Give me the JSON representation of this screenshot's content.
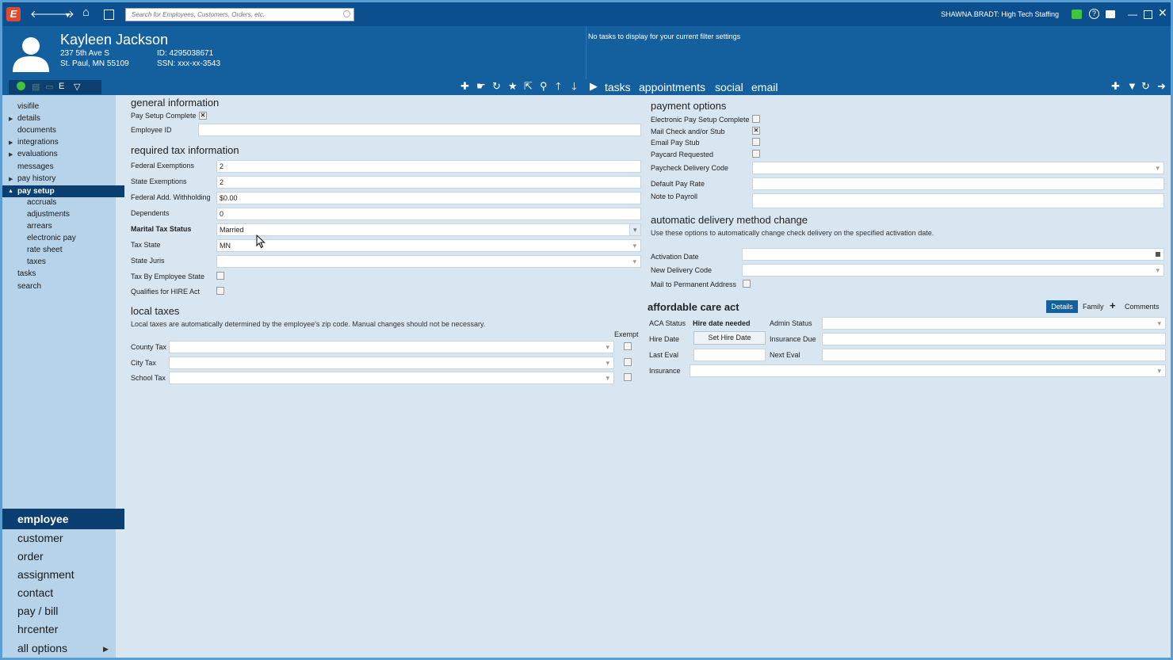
{
  "titlebar": {
    "search_placeholder": "Search for Employees, Customers, Orders, etc.",
    "user": "SHAWNA.BRADT: High Tech Staffing"
  },
  "record": {
    "name": "Kayleen Jackson",
    "address1": "237 5th Ave S",
    "address2": "St. Paul, MN 55109",
    "id": "ID: 4295038671",
    "ssn": "SSN: xxx-xx-3543"
  },
  "tasks_message": "No tasks to display for your current filter settings",
  "status_letter": "E",
  "header_tabs": [
    "tasks",
    "appointments",
    "social",
    "email"
  ],
  "sidebar": {
    "items": [
      "visifile",
      "details",
      "documents",
      "integrations",
      "evaluations",
      "messages",
      "pay history",
      "pay setup"
    ],
    "subitems": [
      "accruals",
      "adjustments",
      "arrears",
      "electronic pay",
      "rate sheet",
      "taxes"
    ],
    "after": [
      "tasks",
      "search"
    ],
    "bignav": [
      "employee",
      "customer",
      "order",
      "assignment",
      "contact",
      "pay / bill",
      "hrcenter",
      "all options"
    ]
  },
  "general": {
    "title": "general information",
    "pay_setup_complete": "Pay Setup Complete",
    "employee_id": "Employee ID"
  },
  "tax": {
    "title": "required tax information",
    "federal_exemptions_label": "Federal Exemptions",
    "federal_exemptions": "2",
    "state_exemptions_label": "State Exemptions",
    "state_exemptions": "2",
    "federal_add_label": "Federal Add. Withholding",
    "federal_add": "$0.00",
    "dependents_label": "Dependents",
    "dependents": "0",
    "marital_label": "Marital Tax Status",
    "marital": "Married",
    "tax_state_label": "Tax State",
    "tax_state": "MN",
    "state_juris_label": "State Juris",
    "tax_by_state_label": "Tax By Employee State",
    "hire_act_label": "Qualifies for HIRE Act"
  },
  "local": {
    "title": "local taxes",
    "note": "Local taxes are automatically determined by the employee's zip code. Manual changes should not be necessary.",
    "exempt": "Exempt",
    "county": "County Tax",
    "city": "City Tax",
    "school": "School Tax"
  },
  "payment": {
    "title": "payment options",
    "electronic": "Electronic Pay Setup Complete",
    "mail_check": "Mail Check and/or Stub",
    "email_stub": "Email Pay Stub",
    "paycard": "Paycard Requested",
    "delivery_code": "Paycheck Delivery Code",
    "default_rate": "Default Pay Rate",
    "note_payroll": "Note to Payroll"
  },
  "auto": {
    "title": "automatic delivery method change",
    "note": "Use these options to automatically change check delivery on the specified activation date.",
    "activation": "Activation Date",
    "new_code": "New Delivery Code",
    "mail_perm": "Mail to Permanent Address"
  },
  "aca": {
    "title": "affordable care act",
    "tab_details": "Details",
    "tab_family": "Family",
    "tab_comments": "Comments",
    "status_label": "ACA Status",
    "status_value": "Hire date needed",
    "admin_status": "Admin Status",
    "hire_date": "Hire Date",
    "set_hire_date": "Set Hire Date",
    "insurance_due": "Insurance Due",
    "last_eval": "Last Eval",
    "next_eval": "Next Eval",
    "insurance": "Insurance"
  },
  "colors": {
    "titlebar": "#0c4f8f",
    "header": "#14609f",
    "active_nav": "#0b3f72",
    "sidebar": "#b7d3ea",
    "content": "#d8e6f1"
  }
}
